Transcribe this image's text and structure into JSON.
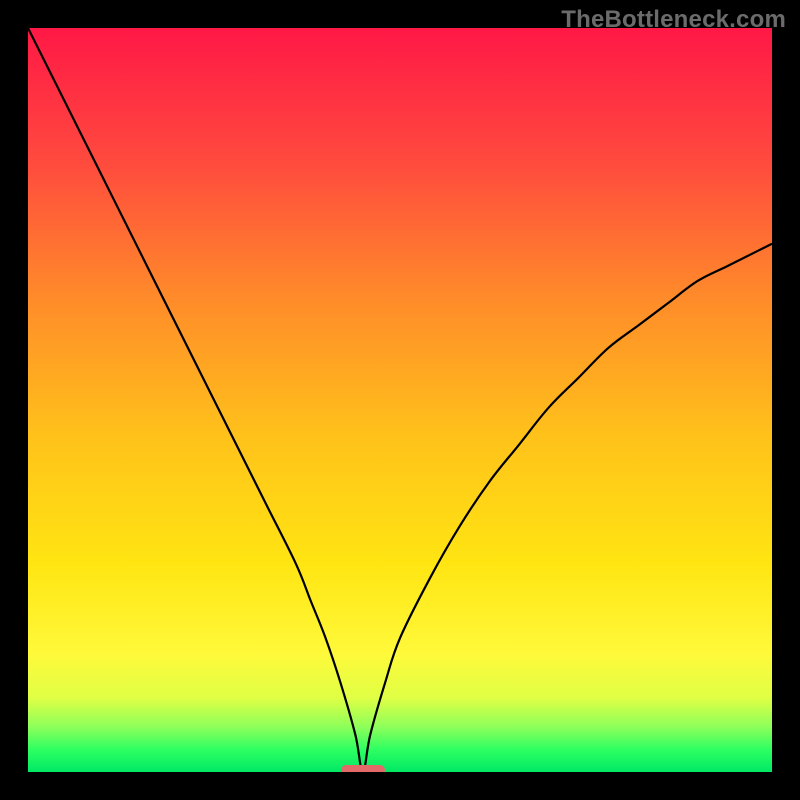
{
  "watermark": "TheBottleneck.com",
  "chart_data": {
    "type": "line",
    "title": "",
    "xlabel": "",
    "ylabel": "",
    "xlim": [
      0,
      100
    ],
    "ylim": [
      0,
      100
    ],
    "x_min_marker": 45,
    "series": [
      {
        "name": "curve",
        "x": [
          0,
          4,
          8,
          12,
          16,
          20,
          24,
          28,
          32,
          36,
          38,
          40,
          42,
          44,
          45,
          46,
          48,
          50,
          54,
          58,
          62,
          66,
          70,
          74,
          78,
          82,
          86,
          90,
          94,
          98,
          100
        ],
        "values": [
          100,
          92,
          84,
          76,
          68,
          60,
          52,
          44,
          36,
          28,
          23,
          18,
          12,
          5,
          0,
          5,
          12,
          18,
          26,
          33,
          39,
          44,
          49,
          53,
          57,
          60,
          63,
          66,
          68,
          70,
          71
        ]
      }
    ],
    "marker": {
      "color": "#e46a6a",
      "x": 45
    },
    "gradient_stops": [
      {
        "pos": 0,
        "color": "#ff1846"
      },
      {
        "pos": 55,
        "color": "#ffc21a"
      },
      {
        "pos": 84,
        "color": "#fff93a"
      },
      {
        "pos": 100,
        "color": "#00e864"
      }
    ]
  }
}
